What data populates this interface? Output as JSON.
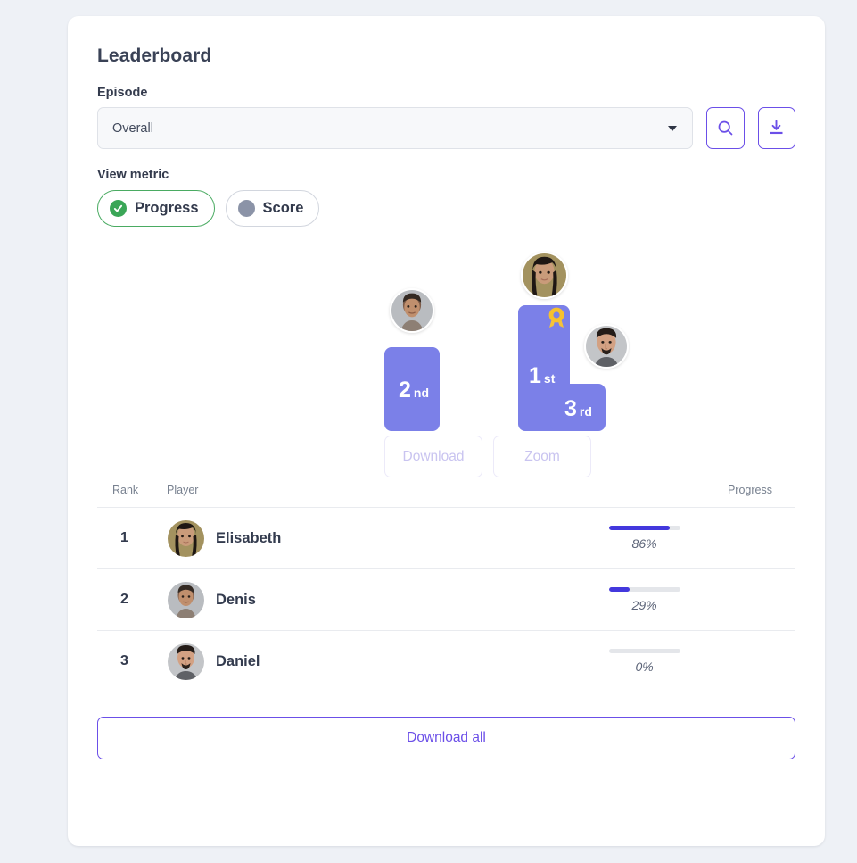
{
  "page": {
    "title": "Leaderboard",
    "background_color": "#eef1f6",
    "accent_color": "#6b4fe8"
  },
  "episode": {
    "label": "Episode",
    "selected": "Overall",
    "search_icon": "search-icon",
    "download_icon": "download-icon"
  },
  "view_metric": {
    "label": "View metric",
    "options": [
      {
        "label": "Progress",
        "selected": true,
        "icon": "check-circle-icon",
        "color": "#3aa657"
      },
      {
        "label": "Score",
        "selected": false,
        "icon": "filled-circle-icon",
        "color": "#8b93a7"
      }
    ]
  },
  "podium": {
    "bar_color": "#7b80e8",
    "places": [
      {
        "rank": "2",
        "ordinal": "nd",
        "player": "Denis"
      },
      {
        "rank": "1",
        "ordinal": "st",
        "player": "Elisabeth",
        "medal": true
      },
      {
        "rank": "3",
        "ordinal": "rd",
        "player": "Daniel"
      }
    ],
    "actions": [
      {
        "label": "Download",
        "disabled": true
      },
      {
        "label": "Zoom",
        "disabled": true
      }
    ]
  },
  "table": {
    "columns": [
      "Rank",
      "Player",
      "Progress"
    ],
    "rows": [
      {
        "rank": "1",
        "player": "Elisabeth",
        "progress": 86,
        "progress_label": "86%"
      },
      {
        "rank": "2",
        "player": "Denis",
        "progress": 29,
        "progress_label": "29%"
      },
      {
        "rank": "3",
        "player": "Daniel",
        "progress": 0,
        "progress_label": "0%"
      }
    ]
  },
  "footer": {
    "download_all_label": "Download all"
  },
  "chart_data": {
    "type": "bar",
    "title": "Leaderboard",
    "categories": [
      "Elisabeth",
      "Denis",
      "Daniel"
    ],
    "values": [
      86,
      29,
      0
    ],
    "ranks": [
      1,
      2,
      3
    ],
    "ylabel": "Progress",
    "xlabel": "",
    "ylim": [
      0,
      100
    ]
  }
}
